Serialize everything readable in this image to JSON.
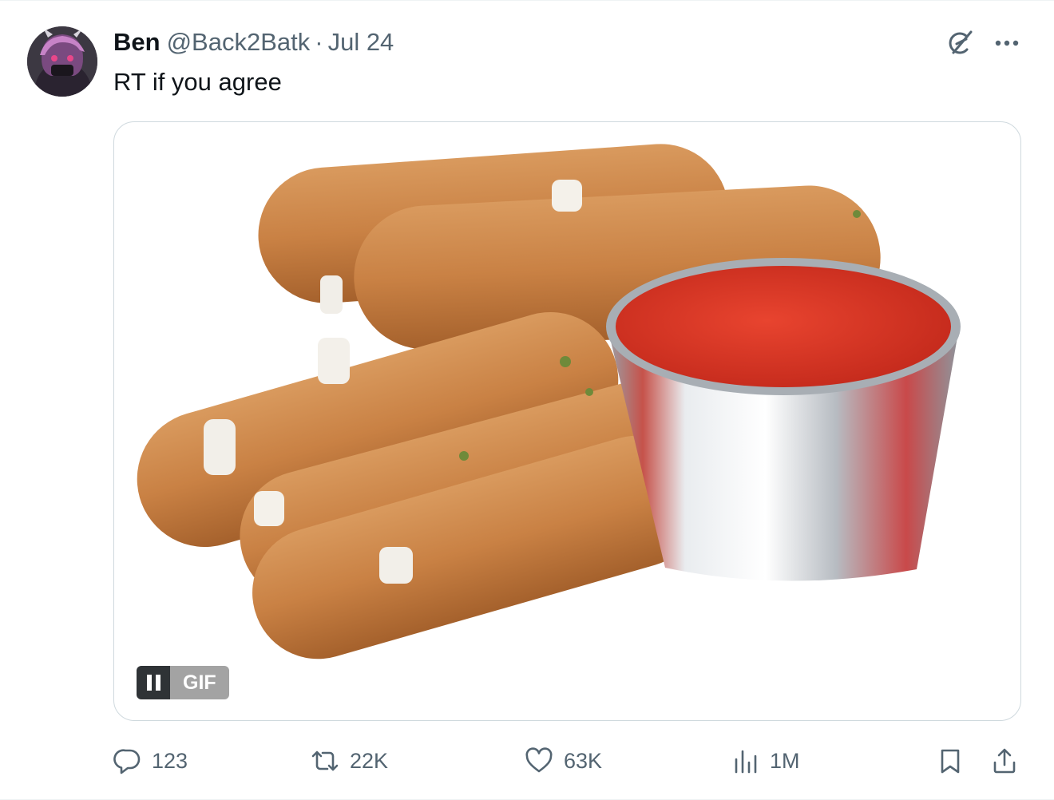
{
  "tweet": {
    "author": {
      "display_name": "Ben",
      "handle": "@Back2Batk",
      "separator": "·",
      "date": "Jul 24"
    },
    "text": "RT if you agree",
    "media": {
      "type": "gif",
      "gif_label": "GIF",
      "paused": false
    },
    "metrics": {
      "replies": "123",
      "reposts": "22K",
      "likes": "63K",
      "views": "1M"
    }
  },
  "icons": {
    "grok": "grok-icon",
    "more": "more-icon",
    "reply": "reply-icon",
    "repost": "repost-icon",
    "like": "like-icon",
    "views": "views-icon",
    "bookmark": "bookmark-icon",
    "share": "share-icon",
    "pause": "pause-icon"
  },
  "colors": {
    "text_primary": "#0f1419",
    "text_secondary": "#536471",
    "border": "#cfd9de"
  }
}
